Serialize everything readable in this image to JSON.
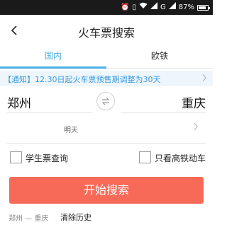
{
  "status_bar": {
    "battery_percent": "87%",
    "network": "G",
    "battery_level": 0.87
  },
  "header": {
    "title": "火车票搜索"
  },
  "tabs": [
    {
      "label": "国内",
      "active": true
    },
    {
      "label": "欧铁",
      "active": false
    }
  ],
  "notice": {
    "text": "【通知】12.30日起火车票预售期调整为30天"
  },
  "search": {
    "from_station": "郑州",
    "to_station": "重庆",
    "date": "明天",
    "options": [
      {
        "label": "学生票查询",
        "checked": false
      },
      {
        "label": "只看高铁动车",
        "checked": false
      }
    ],
    "search_label": "开始搜索"
  },
  "history": {
    "item": "郑州 — 重庆",
    "clear_label": "清除历史"
  },
  "colors": {
    "accent": "#4ab0e6",
    "search_button": "#f66a57",
    "status_bar": "#1a1a1a",
    "notice_bg": "#eef6fc"
  }
}
